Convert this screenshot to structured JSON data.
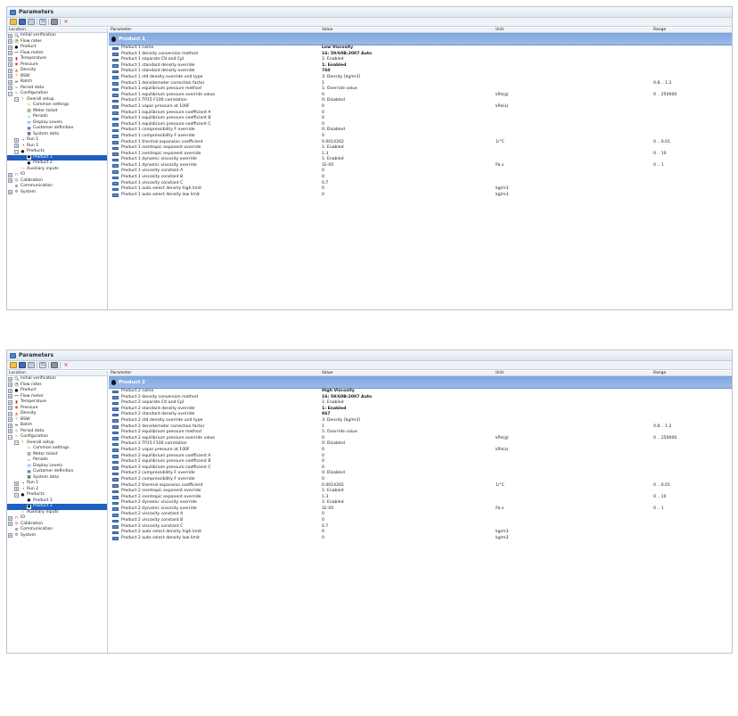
{
  "window_title": "Parameters",
  "tree_header": "Location",
  "columns": {
    "parameter": "Parameter",
    "value": "Value",
    "unit": "Unit",
    "range": "Range"
  },
  "accent": "#1f5fbf",
  "band_color": "#8eb1e4",
  "tree_items": [
    {
      "label": "Initial verification",
      "level": 0,
      "expander": "+",
      "icon": "magnifier-icon"
    },
    {
      "label": "Flow rates",
      "level": 0,
      "expander": "+",
      "icon": "gauge-icon"
    },
    {
      "label": "Product",
      "level": 0,
      "expander": "+",
      "icon": "drop-icon"
    },
    {
      "label": "Flow meter",
      "level": 0,
      "expander": "+",
      "icon": "flowmeter-icon"
    },
    {
      "label": "Temperature",
      "level": 0,
      "expander": "+",
      "icon": "thermometer-icon"
    },
    {
      "label": "Pressure",
      "level": 0,
      "expander": "+",
      "icon": "pressure-icon"
    },
    {
      "label": "Density",
      "level": 0,
      "expander": "+",
      "icon": "density-icon"
    },
    {
      "label": "BSW",
      "level": 0,
      "expander": "+",
      "icon": "bsw-icon"
    },
    {
      "label": "Batch",
      "level": 0,
      "expander": "+",
      "icon": "batch-icon"
    },
    {
      "label": "Period data",
      "level": 0,
      "expander": "+",
      "icon": "period-icon"
    },
    {
      "label": "Configuration",
      "level": 0,
      "expander": "−",
      "icon": "config-icon"
    },
    {
      "label": "Overall setup",
      "level": 1,
      "expander": "−",
      "icon": "config-icon"
    },
    {
      "label": "Common settings",
      "level": 2,
      "expander": "",
      "icon": "config-icon"
    },
    {
      "label": "Meter ticket",
      "level": 2,
      "expander": "",
      "icon": "ticket-icon"
    },
    {
      "label": "Periods",
      "level": 2,
      "expander": "",
      "icon": "period-icon"
    },
    {
      "label": "Display Levels",
      "level": 2,
      "expander": "",
      "icon": "display-icon"
    },
    {
      "label": "Customer definition",
      "level": 2,
      "expander": "",
      "icon": "customer-icon"
    },
    {
      "label": "System data",
      "level": 2,
      "expander": "",
      "icon": "system-data-icon"
    },
    {
      "label": "Run 1",
      "level": 1,
      "expander": "+",
      "icon": "run-icon"
    },
    {
      "label": "Run 2",
      "level": 1,
      "expander": "+",
      "icon": "run-icon"
    },
    {
      "label": "Products",
      "level": 1,
      "expander": "−",
      "icon": "drop-icon"
    },
    {
      "label": "Product 1",
      "level": 2,
      "expander": "",
      "icon": "drop-icon"
    },
    {
      "label": "Product 2",
      "level": 2,
      "expander": "",
      "icon": "drop-icon"
    },
    {
      "label": "Auxiliary inputs",
      "level": 1,
      "expander": "",
      "icon": "aux-icon"
    },
    {
      "label": "IO",
      "level": 0,
      "expander": "+",
      "icon": "io-icon"
    },
    {
      "label": "Calibration",
      "level": 0,
      "expander": "+",
      "icon": "calibration-icon"
    },
    {
      "label": "Communication",
      "level": 0,
      "expander": "",
      "icon": "network-icon"
    },
    {
      "label": "System",
      "level": 0,
      "expander": "+",
      "icon": "gear-icon"
    }
  ],
  "panels": [
    {
      "product": "Product 1",
      "selected_tree_index": 21,
      "rows": [
        {
          "name": "Product 1 name",
          "value": "Low Viscosity",
          "unit": "",
          "range": "",
          "bold": true
        },
        {
          "name": "Product 1 density conversion method",
          "value": "16: 59/60B:2007 Auto",
          "unit": "",
          "range": "",
          "bold": true
        },
        {
          "name": "Product 1 separate Ctl and Cpl",
          "value": "1: Enabled",
          "unit": "",
          "range": "",
          "bold": false
        },
        {
          "name": "Product 1 standard density override",
          "value": "1: Enabled",
          "unit": "",
          "range": "",
          "bold": true
        },
        {
          "name": "Product 1 standard density override",
          "value": "760",
          "unit": "",
          "range": "",
          "bold": true
        },
        {
          "name": "Product 1 std density override unit type",
          "value": "3: Density [kg/m3]",
          "unit": "",
          "range": "",
          "bold": false
        },
        {
          "name": "Product 1 densitometer correction factor",
          "value": "1",
          "unit": "",
          "range": "0.8 .. 1.2",
          "bold": false
        },
        {
          "name": "Product 1 equilibrium pressure method",
          "value": "1: Override value",
          "unit": "",
          "range": "",
          "bold": false
        },
        {
          "name": "Product 1 equilibrium pressure override value",
          "value": "0",
          "unit": "kPa(g)",
          "range": "0 .. 250000",
          "bold": false
        },
        {
          "name": "Product 1 TP15 F100 correlation",
          "value": "0: Disabled",
          "unit": "",
          "range": "",
          "bold": false
        },
        {
          "name": "Product 1 vapor pressure at 100F",
          "value": "0",
          "unit": "kPa(a)",
          "range": "",
          "bold": false
        },
        {
          "name": "Product 1 equilibrium pressure coefficient A",
          "value": "0",
          "unit": "",
          "range": "",
          "bold": false
        },
        {
          "name": "Product 1 equilibrium pressure coefficient B",
          "value": "0",
          "unit": "",
          "range": "",
          "bold": false
        },
        {
          "name": "Product 1 equilibrium pressure coefficient C",
          "value": "0",
          "unit": "",
          "range": "",
          "bold": false
        },
        {
          "name": "Product 1 compressibility F override",
          "value": "0: Disabled",
          "unit": "",
          "range": "",
          "bold": false
        },
        {
          "name": "Product 1 compressibility F override",
          "value": "0",
          "unit": "",
          "range": "",
          "bold": false
        },
        {
          "name": "Product 1 thermal expansion coefficient",
          "value": "0.0014202",
          "unit": "1/°C",
          "range": "0 .. 0.01",
          "bold": false
        },
        {
          "name": "Product 1 isentropic exponent override",
          "value": "1: Enabled",
          "unit": "",
          "range": "",
          "bold": false
        },
        {
          "name": "Product 1 isentropic exponent override",
          "value": "1.3",
          "unit": "",
          "range": "0 .. 10",
          "bold": false
        },
        {
          "name": "Product 1 dynamic viscosity override",
          "value": "1: Enabled",
          "unit": "",
          "range": "",
          "bold": false
        },
        {
          "name": "Product 1 dynamic viscosity override",
          "value": "1E-05",
          "unit": "Pa.s",
          "range": "0 .. 1",
          "bold": false
        },
        {
          "name": "Product 1 viscosity constant A",
          "value": "0",
          "unit": "",
          "range": "",
          "bold": false
        },
        {
          "name": "Product 1 viscosity constant B",
          "value": "0",
          "unit": "",
          "range": "",
          "bold": false
        },
        {
          "name": "Product 1 viscosity constant C",
          "value": "0.7",
          "unit": "",
          "range": "",
          "bold": false
        },
        {
          "name": "Product 1 auto select density high limit",
          "value": "0",
          "unit": "kg/m3",
          "range": "",
          "bold": false
        },
        {
          "name": "Product 1 auto select density low limit",
          "value": "0",
          "unit": "kg/m3",
          "range": "",
          "bold": false
        }
      ]
    },
    {
      "product": "Product 2",
      "selected_tree_index": 22,
      "rows": [
        {
          "name": "Product 2 name",
          "value": "High Viscosity",
          "unit": "",
          "range": "",
          "bold": true
        },
        {
          "name": "Product 2 density conversion method",
          "value": "16: 59/60B:2007 Auto",
          "unit": "",
          "range": "",
          "bold": true
        },
        {
          "name": "Product 2 separate Ctl and Cpl",
          "value": "1: Enabled",
          "unit": "",
          "range": "",
          "bold": false
        },
        {
          "name": "Product 2 standard density override",
          "value": "1: Enabled",
          "unit": "",
          "range": "",
          "bold": true
        },
        {
          "name": "Product 2 standard density override",
          "value": "867",
          "unit": "",
          "range": "",
          "bold": true
        },
        {
          "name": "Product 2 std density override unit type",
          "value": "3: Density [kg/m3]",
          "unit": "",
          "range": "",
          "bold": false
        },
        {
          "name": "Product 2 densitometer correction factor",
          "value": "1",
          "unit": "",
          "range": "0.8 .. 1.2",
          "bold": false
        },
        {
          "name": "Product 2 equilibrium pressure method",
          "value": "1: Override value",
          "unit": "",
          "range": "",
          "bold": false
        },
        {
          "name": "Product 2 equilibrium pressure override value",
          "value": "0",
          "unit": "kPa(g)",
          "range": "0 .. 250000",
          "bold": false
        },
        {
          "name": "Product 2 TP15 F100 correlation",
          "value": "0: Disabled",
          "unit": "",
          "range": "",
          "bold": false
        },
        {
          "name": "Product 2 vapor pressure at 100F",
          "value": "0",
          "unit": "kPa(a)",
          "range": "",
          "bold": false
        },
        {
          "name": "Product 2 equilibrium pressure coefficient A",
          "value": "0",
          "unit": "",
          "range": "",
          "bold": false
        },
        {
          "name": "Product 2 equilibrium pressure coefficient B",
          "value": "0",
          "unit": "",
          "range": "",
          "bold": false
        },
        {
          "name": "Product 2 equilibrium pressure coefficient C",
          "value": "0",
          "unit": "",
          "range": "",
          "bold": false
        },
        {
          "name": "Product 2 compressibility F override",
          "value": "0: Disabled",
          "unit": "",
          "range": "",
          "bold": false
        },
        {
          "name": "Product 2 compressibility F override",
          "value": "0",
          "unit": "",
          "range": "",
          "bold": false
        },
        {
          "name": "Product 2 thermal expansion coefficient",
          "value": "0.0014202",
          "unit": "1/°C",
          "range": "0 .. 0.01",
          "bold": false
        },
        {
          "name": "Product 2 isentropic exponent override",
          "value": "1: Enabled",
          "unit": "",
          "range": "",
          "bold": false
        },
        {
          "name": "Product 2 isentropic exponent override",
          "value": "1.3",
          "unit": "",
          "range": "0 .. 10",
          "bold": false
        },
        {
          "name": "Product 2 dynamic viscosity override",
          "value": "1: Enabled",
          "unit": "",
          "range": "",
          "bold": false
        },
        {
          "name": "Product 2 dynamic viscosity override",
          "value": "1E-05",
          "unit": "Pa.s",
          "range": "0 .. 1",
          "bold": false
        },
        {
          "name": "Product 2 viscosity constant A",
          "value": "0",
          "unit": "",
          "range": "",
          "bold": false
        },
        {
          "name": "Product 2 viscosity constant B",
          "value": "0",
          "unit": "",
          "range": "",
          "bold": false
        },
        {
          "name": "Product 2 viscosity constant C",
          "value": "0.7",
          "unit": "",
          "range": "",
          "bold": false
        },
        {
          "name": "Product 2 auto select density high limit",
          "value": "0",
          "unit": "kg/m3",
          "range": "",
          "bold": false
        },
        {
          "name": "Product 2 auto select density low limit",
          "value": "0",
          "unit": "kg/m3",
          "range": "",
          "bold": false
        }
      ]
    }
  ]
}
